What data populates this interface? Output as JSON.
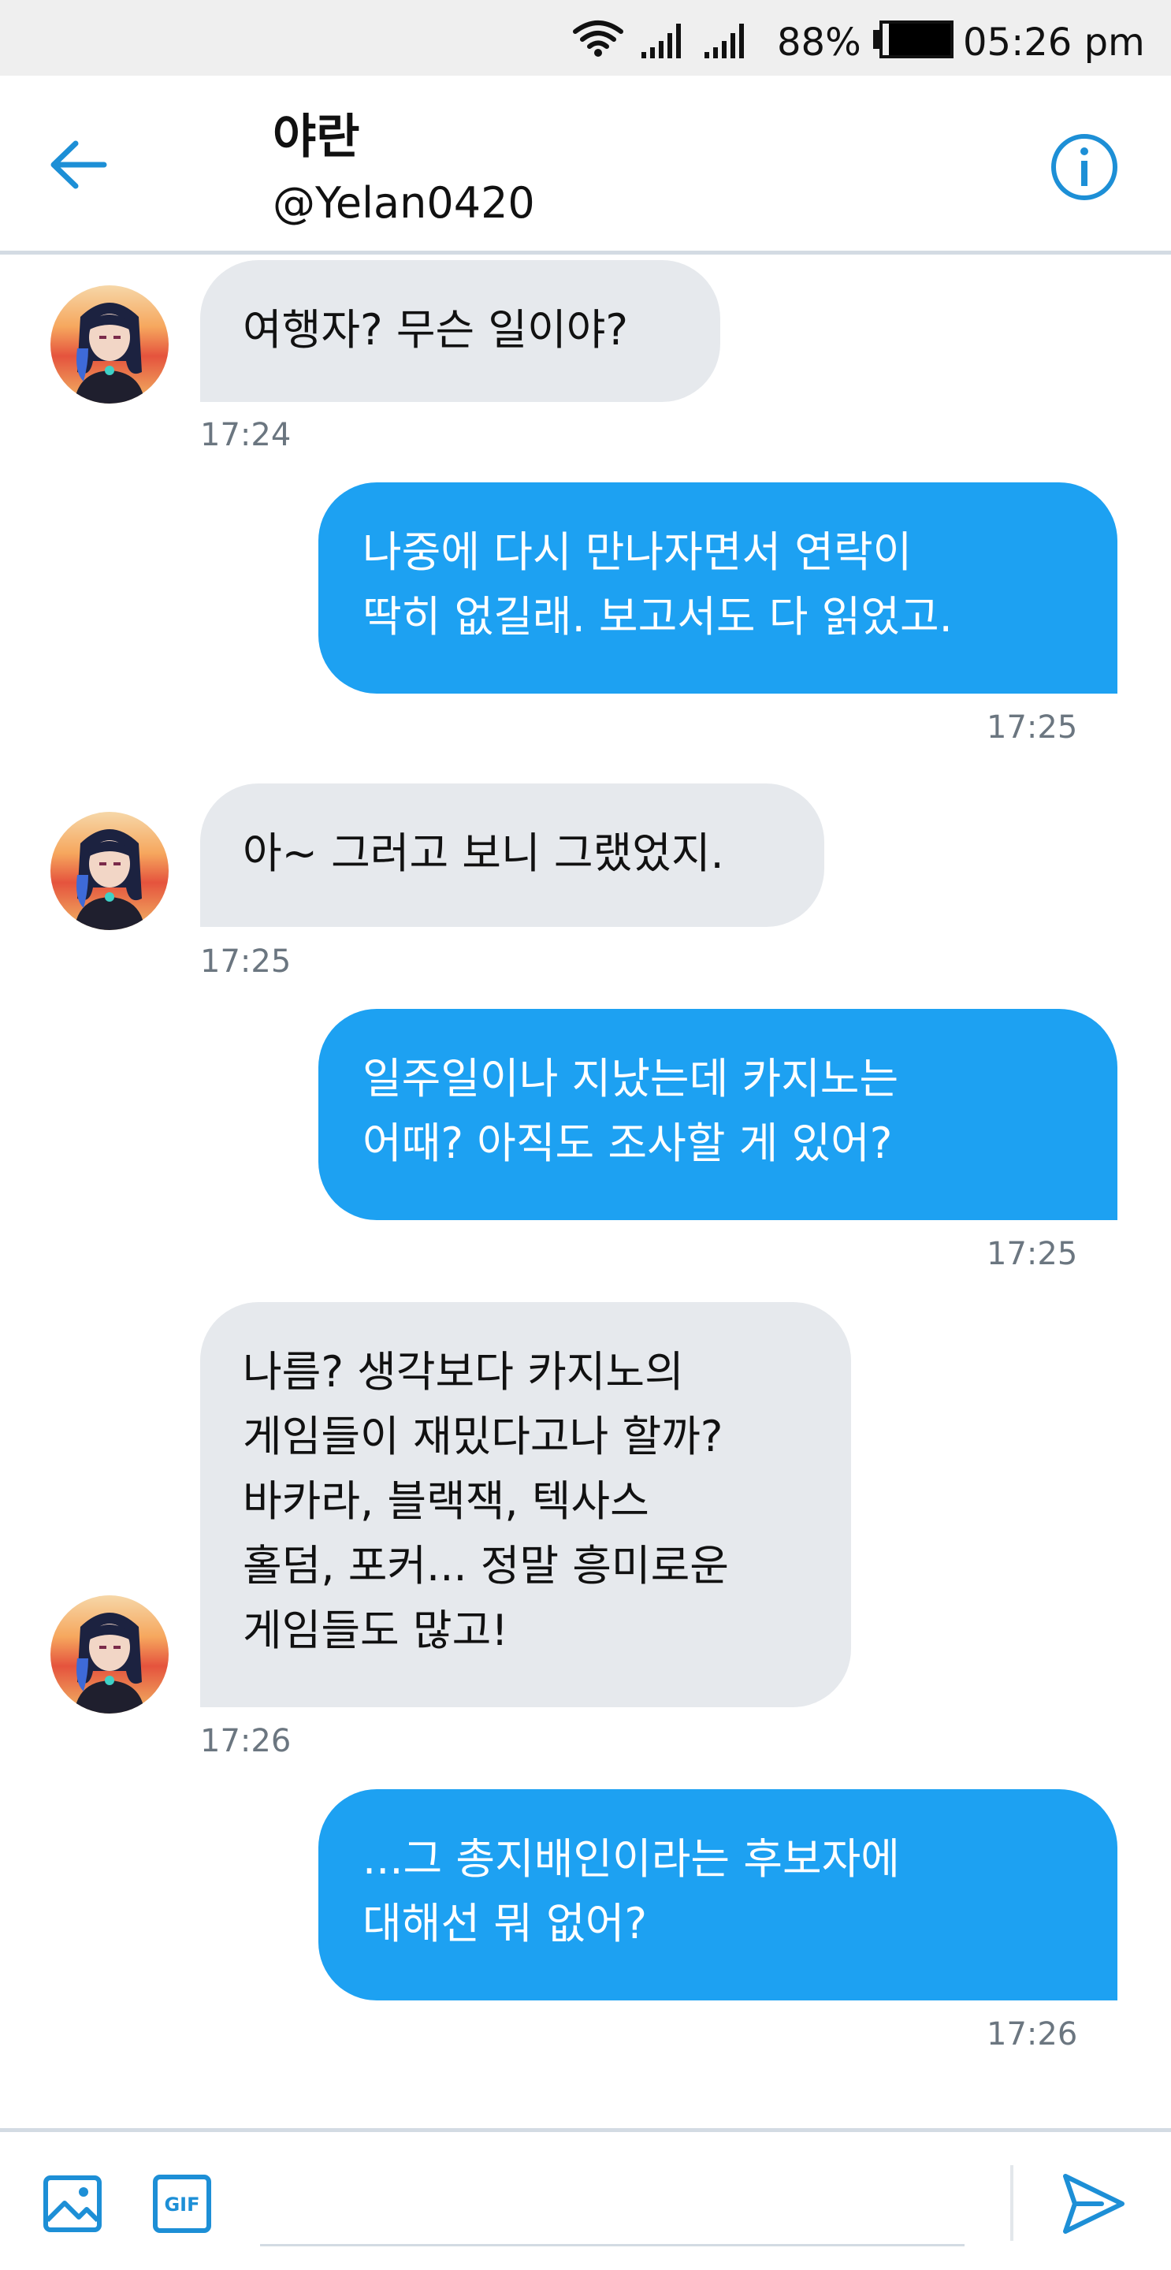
{
  "status_bar": {
    "battery_percent": "88%",
    "time": "05:26 pm",
    "icons": [
      "wifi-icon",
      "signal-icon",
      "signal-icon",
      "battery-icon"
    ]
  },
  "header": {
    "name": "야란",
    "handle": "@Yelan0420",
    "back_icon": "arrow-left-icon",
    "info_icon": "info-icon",
    "accent_color": "#1da1f2"
  },
  "messages": [
    {
      "side": "in",
      "text": "여행자? 무슨 일이야?",
      "time": "17:24"
    },
    {
      "side": "out",
      "text": "나중에 다시 만나자면서 연락이\n딱히 없길래. 보고서도 다 읽었고.",
      "time": "17:25"
    },
    {
      "side": "in",
      "text": "아~ 그러고 보니 그랬었지.",
      "time": "17:25"
    },
    {
      "side": "out",
      "text": "일주일이나 지났는데 카지노는\n어때? 아직도 조사할 게 있어?",
      "time": "17:25"
    },
    {
      "side": "in",
      "text": "나름? 생각보다 카지노의\n게임들이 재밌다고나 할까?\n바카라, 블랙잭, 텍사스\n홀덤, 포커... 정말 흥미로운\n게임들도 많고!",
      "time": "17:26"
    },
    {
      "side": "out",
      "text": "...그 총지배인이라는 후보자에\n대해선 뭐 없어?",
      "time": "17:26"
    }
  ],
  "composer": {
    "image_icon": "image-icon",
    "gif_label": "GIF",
    "input_value": "",
    "send_icon": "send-icon"
  },
  "colors": {
    "outgoing_bubble": "#1da1f2",
    "incoming_bubble": "#e6e9ed",
    "timestamp": "#6b7680",
    "status_bar_bg": "#efefef"
  }
}
